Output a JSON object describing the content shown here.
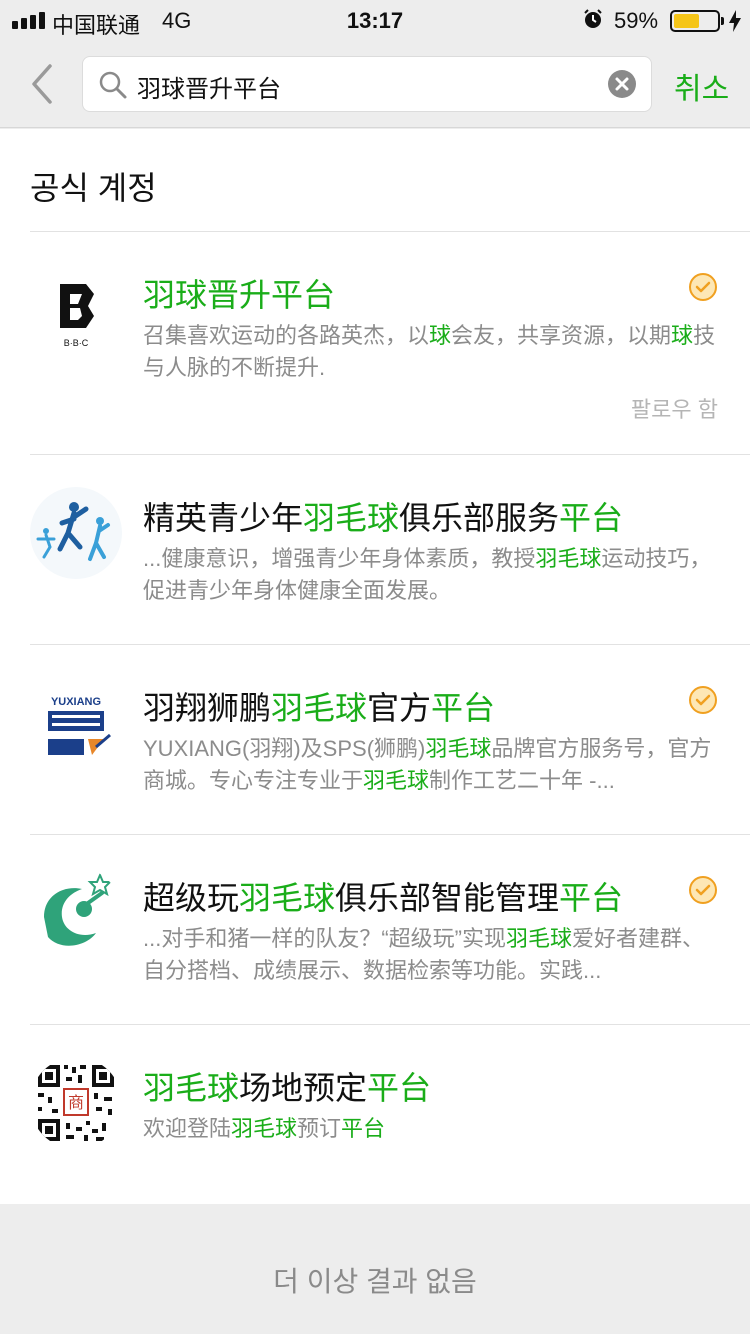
{
  "status_bar": {
    "carrier": "中国联通",
    "network": "4G",
    "time": "13:17",
    "battery": "59%",
    "battery_level": 0.59,
    "signal_icon": "signal-bars-icon",
    "alarm_icon": "alarm-icon",
    "charging_icon": "charging-bolt-icon"
  },
  "search": {
    "query": "羽球晋升平台",
    "cancel_label": "취소",
    "back_icon": "chevron-left-icon",
    "search_icon": "search-icon",
    "clear_icon": "clear-icon"
  },
  "section": {
    "title": "공식 계정"
  },
  "results": [
    {
      "title": [
        {
          "t": "羽球晋升平台",
          "hl": true
        }
      ],
      "desc": [
        {
          "t": "召集喜欢运动的各路英杰，以",
          "hl": false
        },
        {
          "t": "球",
          "hl": true
        },
        {
          "t": "会友，共享资源，以期",
          "hl": false
        },
        {
          "t": "球",
          "hl": true
        },
        {
          "t": "技与人脉的不断提升.",
          "hl": false
        }
      ],
      "verified": true,
      "follow_status": "팔로우 함",
      "avatar_text": "B·B·C"
    },
    {
      "title": [
        {
          "t": "精英青少年",
          "hl": false
        },
        {
          "t": "羽毛球",
          "hl": true
        },
        {
          "t": "俱乐部服务",
          "hl": false
        },
        {
          "t": "平台",
          "hl": true
        }
      ],
      "desc": [
        {
          "t": "...健康意识，增强青少年身体素质，教授",
          "hl": false
        },
        {
          "t": "羽毛球",
          "hl": true
        },
        {
          "t": "运动技巧，促进青少年身体健康全面发展。",
          "hl": false
        }
      ],
      "verified": false
    },
    {
      "title": [
        {
          "t": "羽翔狮鹏",
          "hl": false
        },
        {
          "t": "羽毛球",
          "hl": true
        },
        {
          "t": "官方",
          "hl": false
        },
        {
          "t": "平台",
          "hl": true
        }
      ],
      "desc": [
        {
          "t": "YUXIANG(羽翔)及SPS(狮鹏)",
          "hl": false
        },
        {
          "t": "羽毛球",
          "hl": true
        },
        {
          "t": "品牌官方服务号，官方商城。专心专注专业于",
          "hl": false
        },
        {
          "t": "羽毛球",
          "hl": true
        },
        {
          "t": "制作工艺二十年 -...",
          "hl": false
        }
      ],
      "verified": true,
      "avatar_text": "YUXIANG"
    },
    {
      "title": [
        {
          "t": "超级玩",
          "hl": false
        },
        {
          "t": "羽毛球",
          "hl": true
        },
        {
          "t": "俱乐部智能管理",
          "hl": false
        },
        {
          "t": "平台",
          "hl": true
        }
      ],
      "desc": [
        {
          "t": "...对手和猪一样的队友？“超级玩”实现",
          "hl": false
        },
        {
          "t": "羽毛球",
          "hl": true
        },
        {
          "t": "爱好者建群、自分搭档、成绩展示、数据检索等功能。实践...",
          "hl": false
        }
      ],
      "verified": true
    },
    {
      "title": [
        {
          "t": "羽毛球",
          "hl": true
        },
        {
          "t": "场地预定",
          "hl": false
        },
        {
          "t": "平台",
          "hl": true
        }
      ],
      "desc": [
        {
          "t": "欢迎登陆",
          "hl": false
        },
        {
          "t": "羽毛球",
          "hl": true
        },
        {
          "t": "预订",
          "hl": false
        },
        {
          "t": "平台",
          "hl": true
        }
      ],
      "verified": false,
      "avatar_text": "商"
    }
  ],
  "footer": {
    "no_more_label": "더 이상 결과 없음"
  },
  "colors": {
    "accent": "#1aad19",
    "verified": "#f0a020",
    "muted_text": "#8c8c8c",
    "background": "#ededed"
  }
}
